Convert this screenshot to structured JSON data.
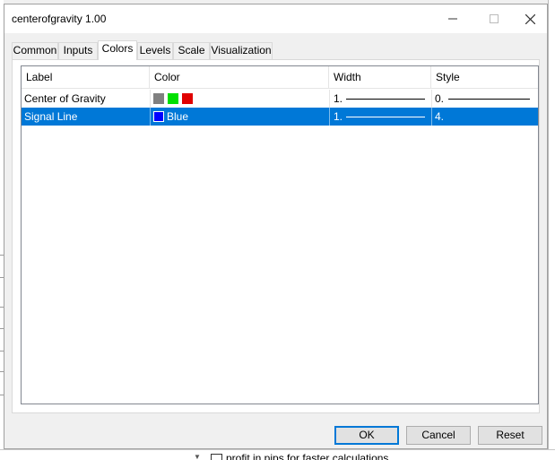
{
  "window": {
    "title": "centerofgravity 1.00"
  },
  "tabs": [
    {
      "label": "Common"
    },
    {
      "label": "Inputs"
    },
    {
      "label": "Colors"
    },
    {
      "label": "Levels"
    },
    {
      "label": "Scale"
    },
    {
      "label": "Visualization"
    }
  ],
  "active_tab": "Colors",
  "table": {
    "columns": [
      "Label",
      "Color",
      "Width",
      "Style"
    ],
    "rows": [
      {
        "label": "Center of Gravity",
        "colors": [
          "#808080",
          "#00e000",
          "#e00000"
        ],
        "color_name": "",
        "width": "1.",
        "style": "0.",
        "style_kind": "solid",
        "selected": false
      },
      {
        "label": "Signal Line",
        "colors": [
          "#0000ff"
        ],
        "color_name": "Blue",
        "width": "1.",
        "style": "4.",
        "style_kind": "dash-dot-dot",
        "selected": true
      }
    ]
  },
  "buttons": {
    "ok": "OK",
    "cancel": "Cancel",
    "reset": "Reset"
  },
  "background": {
    "checkbox_text": "profit in pips for faster calculations"
  },
  "accent_color": "#0078d7"
}
